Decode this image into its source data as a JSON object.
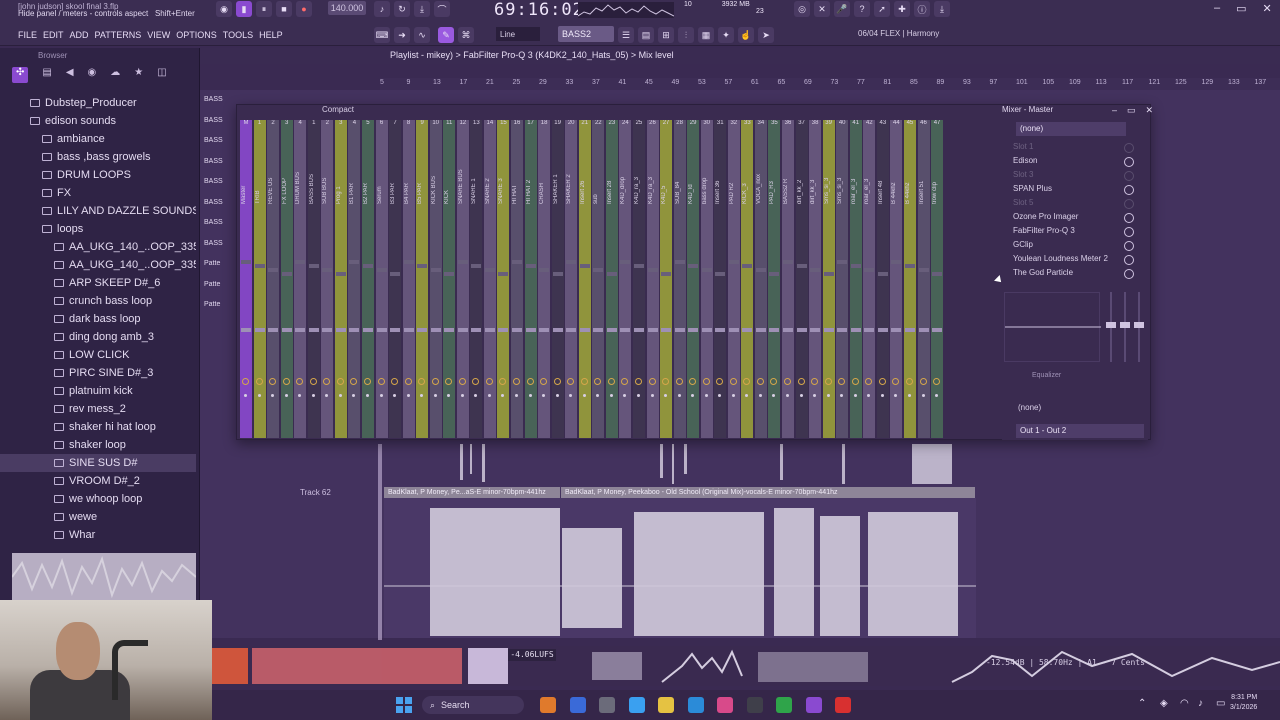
{
  "app": {
    "project_file": "[john judson] skool final 3.flp",
    "hint_text": "Hide panel / meters - controls aspect",
    "hint_shortcut": "Shift+Enter",
    "menu": [
      "FILE",
      "EDIT",
      "ADD",
      "PATTERNS",
      "VIEW",
      "OPTIONS",
      "TOOLS",
      "HELP"
    ],
    "song_time": "69:16:02",
    "tempo": "140.000",
    "pattern": "BASS2",
    "snap": "Line",
    "flex_info": "06/04  FLEX | Harmony",
    "cpu": "10",
    "ram": "3932 MB",
    "voices": "23"
  },
  "browser": {
    "title": "Browser",
    "items": [
      {
        "label": "Dubstep_Producer",
        "level": 1
      },
      {
        "label": "edison sounds",
        "level": 1
      },
      {
        "label": "ambiance",
        "level": 2
      },
      {
        "label": "bass ,bass growels",
        "level": 2
      },
      {
        "label": "DRUM LOOPS",
        "level": 2
      },
      {
        "label": "FX",
        "level": 2
      },
      {
        "label": "LILY AND DAZZLE SOUNDS",
        "level": 2
      },
      {
        "label": "loops",
        "level": 2
      },
      {
        "label": "AA_UKG_140_..OOP_3358632",
        "level": 3
      },
      {
        "label": "AA_UKG_140_..OOP_3358633",
        "level": 3
      },
      {
        "label": "ARP SKEEP D#_6",
        "level": 3
      },
      {
        "label": "crunch bass loop",
        "level": 3
      },
      {
        "label": "dark bass loop",
        "level": 3
      },
      {
        "label": "ding dong amb_3",
        "level": 3
      },
      {
        "label": "LOW CLICK",
        "level": 3
      },
      {
        "label": "PIRC SINE D#_3",
        "level": 3
      },
      {
        "label": "platnuim kick",
        "level": 3
      },
      {
        "label": "rev mess_2",
        "level": 3
      },
      {
        "label": "shaker hi hat loop",
        "level": 3
      },
      {
        "label": "shaker loop",
        "level": 3
      },
      {
        "label": "SINE SUS D#",
        "level": 3,
        "selected": true
      },
      {
        "label": "VROOM D#_2",
        "level": 3
      },
      {
        "label": "we whoop loop",
        "level": 3
      },
      {
        "label": "wewe",
        "level": 3
      },
      {
        "label": "Whar",
        "level": 3
      }
    ]
  },
  "playlist": {
    "title": "Playlist - mikey) > FabFilter Pro-Q 3 (K4DK2_140_Hats_05) > Mix level",
    "ruler": [
      "5",
      "9",
      "13",
      "17",
      "21",
      "25",
      "29",
      "33",
      "37",
      "41",
      "45",
      "49",
      "53",
      "57",
      "61",
      "65",
      "69",
      "73",
      "77",
      "81",
      "85",
      "89",
      "93",
      "97",
      "101",
      "105",
      "109",
      "113",
      "117",
      "121",
      "125",
      "129",
      "133",
      "137"
    ],
    "track_label": "Track 62",
    "clip1": "BadKlaat, P Money, Pe...aS-E minor-70bpm-441hz",
    "clip2": "BadKlaat, P Money, Peekaboo - Old School (Original Mix)-vocals-E minor-70bpm-441hz",
    "left_tracks": [
      "BASS",
      "BASS",
      "BASS",
      "BASS",
      "BASS",
      "BASS",
      "BASS",
      "BASS",
      "Patte",
      "Patte",
      "Patte"
    ]
  },
  "mixer": {
    "title": "Mixer - Master",
    "view_label": "Compact",
    "channels": [
      {
        "num": "M",
        "name": "Master"
      },
      {
        "num": "1",
        "name": "TRIB"
      },
      {
        "num": "2",
        "name": "REVE US"
      },
      {
        "num": "3",
        "name": "FX LOOP"
      },
      {
        "num": "4",
        "name": "DRUM BUS"
      },
      {
        "num": "1",
        "name": "BASS BUS"
      },
      {
        "num": "2",
        "name": "SUB BUS"
      },
      {
        "num": "3",
        "name": "Prog 1"
      },
      {
        "num": "4",
        "name": "B1 PAR"
      },
      {
        "num": "5",
        "name": "B2 PAR"
      },
      {
        "num": "6",
        "name": "Serum"
      },
      {
        "num": "7",
        "name": "B3 PAR"
      },
      {
        "num": "8",
        "name": "B4 PAR"
      },
      {
        "num": "9",
        "name": "B5 PAR"
      },
      {
        "num": "10",
        "name": "KICK BUS"
      },
      {
        "num": "11",
        "name": "KICK"
      },
      {
        "num": "12",
        "name": "SNARE BUS"
      },
      {
        "num": "13",
        "name": "SNARE 1"
      },
      {
        "num": "14",
        "name": "SNARE 2"
      },
      {
        "num": "15",
        "name": "SNARE 3"
      },
      {
        "num": "16",
        "name": "HI HAT"
      },
      {
        "num": "17",
        "name": "HI HAT 2"
      },
      {
        "num": "18",
        "name": "CRASH"
      },
      {
        "num": "19",
        "name": "SHAKER 1"
      },
      {
        "num": "20",
        "name": "SHAKER 2"
      },
      {
        "num": "21",
        "name": "Insert 26"
      },
      {
        "num": "22",
        "name": "sub"
      },
      {
        "num": "23",
        "name": "Insert 28"
      },
      {
        "num": "24",
        "name": "K4D_drop"
      },
      {
        "num": "25",
        "name": "K4D_ra_3"
      },
      {
        "num": "26",
        "name": "K4D_ra_3"
      },
      {
        "num": "27",
        "name": "K4D_5"
      },
      {
        "num": "28",
        "name": "SUB_84"
      },
      {
        "num": "29",
        "name": "K4D_ld"
      },
      {
        "num": "30",
        "name": "bass drop"
      },
      {
        "num": "31",
        "name": "Insert 36"
      },
      {
        "num": "32",
        "name": "PAD R2"
      },
      {
        "num": "33",
        "name": "KICK_3"
      },
      {
        "num": "34",
        "name": "VOCA_nox"
      },
      {
        "num": "35",
        "name": "PAD_R3"
      },
      {
        "num": "36",
        "name": "BASS2 R"
      },
      {
        "num": "37",
        "name": "dirt_kk_2"
      },
      {
        "num": "38",
        "name": "dirt_kk_3"
      },
      {
        "num": "39",
        "name": "Sms_si_3"
      },
      {
        "num": "40",
        "name": "Sms_si_3"
      },
      {
        "num": "41",
        "name": "roar_el_3"
      },
      {
        "num": "42",
        "name": "roar_el_3"
      },
      {
        "num": "43",
        "name": "Insert 48"
      },
      {
        "num": "44",
        "name": "B 44khz"
      },
      {
        "num": "45",
        "name": "B 44khz"
      },
      {
        "num": "46",
        "name": "Insert 51"
      },
      {
        "num": "47",
        "name": "trow clip"
      }
    ],
    "inserts_top": "(none)",
    "inserts": [
      {
        "label": "Slot 1",
        "dim": true
      },
      {
        "label": "Edison",
        "dim": false
      },
      {
        "label": "Slot 3",
        "dim": true
      },
      {
        "label": "SPAN Plus",
        "dim": false
      },
      {
        "label": "Slot 5",
        "dim": true
      },
      {
        "label": "Ozone Pro Imager",
        "dim": false
      },
      {
        "label": "FabFilter Pro-Q 3",
        "dim": false
      },
      {
        "label": "GClip",
        "dim": false
      },
      {
        "label": "Youlean Loudness Meter 2",
        "dim": false
      },
      {
        "label": "The God Particle",
        "dim": false
      }
    ],
    "eq_label": "Equalizer",
    "inserts_bottom": "(none)",
    "output": "Out 1 - Out 2"
  },
  "visualizer": {
    "lufs": "-4.06LUFS",
    "freq_readout": "-12.54dB | 58.70Hz | A1 - 7 Cents"
  },
  "taskbar": {
    "search": "Search",
    "time": "8:31 PM",
    "date": "3/1/2026",
    "apps": [
      "#e07a2c",
      "#3a6ad8",
      "#6b6b7a",
      "#3aa0f0",
      "#e5c242",
      "#2b8bd8",
      "#d84a8a",
      "#3f3f4a",
      "#2fa44a",
      "#8a4ad0",
      "#d83030"
    ]
  },
  "colors": {
    "accent": "#8a4ad0",
    "background": "#3a2a52",
    "knob_ring": "#e6b44a"
  }
}
